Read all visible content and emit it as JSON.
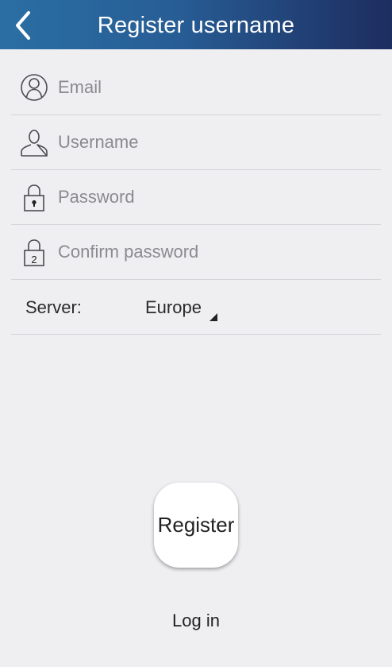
{
  "header": {
    "title": "Register username",
    "back_icon": "chevron-left-icon",
    "gradient": [
      "#2a6fa3",
      "#1d2d5f"
    ]
  },
  "form": {
    "email": {
      "placeholder": "Email",
      "value": "",
      "icon": "user-circle-icon"
    },
    "username": {
      "placeholder": "Username",
      "value": "",
      "icon": "person-icon"
    },
    "password": {
      "placeholder": "Password",
      "value": "",
      "icon": "lock-icon"
    },
    "confirm_password": {
      "placeholder": "Confirm password",
      "value": "",
      "icon": "lock-2-icon",
      "icon_text": "2"
    },
    "server": {
      "label": "Server:",
      "selected": "Europe",
      "icon": "dropdown-triangle-icon"
    }
  },
  "actions": {
    "register_label": "Register",
    "login_label": "Log in"
  },
  "colors": {
    "background": "#efeff2",
    "divider": "#d4d4d8",
    "placeholder": "#8a8a90"
  }
}
